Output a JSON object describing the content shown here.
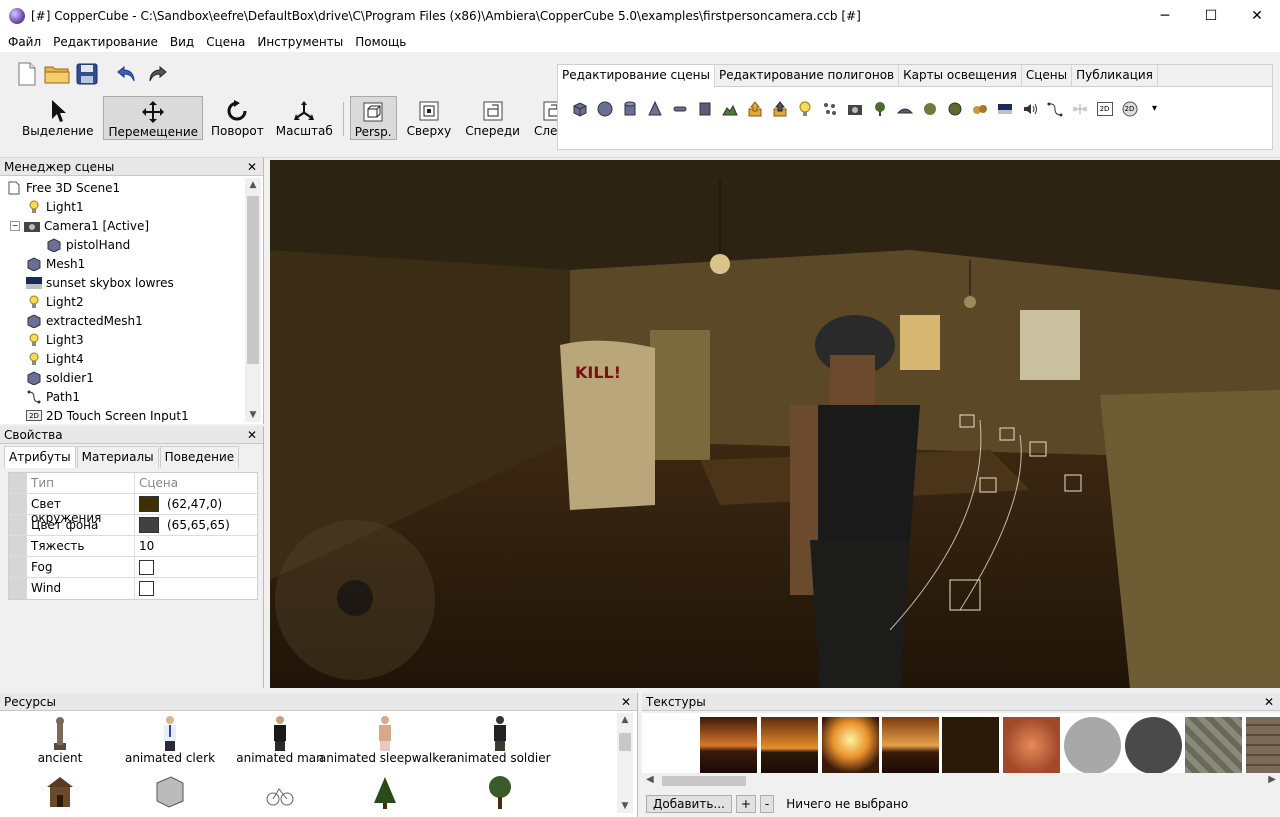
{
  "window": {
    "title": "[#] CopperCube - C:\\Sandbox\\eefre\\DefaultBox\\drive\\C\\Program Files (x86)\\Ambiera\\CopperCube 5.0\\examples\\firstpersoncamera.ccb [#]",
    "minimize": "─",
    "maximize": "☐",
    "close": "✕"
  },
  "menu": [
    "Файл",
    "Редактирование",
    "Вид",
    "Сцена",
    "Инструменты",
    "Помощь"
  ],
  "toolbar": {
    "select": "Выделение",
    "move": "Перемещение",
    "rotate": "Поворот",
    "scale": "Масштаб",
    "persp": "Persp.",
    "top": "Сверху",
    "front": "Спереди",
    "left": "Слева"
  },
  "ribbon": {
    "tabs": [
      "Редактирование сцены",
      "Редактирование полигонов",
      "Карты освещения",
      "Сцены",
      "Публикация"
    ],
    "label_2d": "2D",
    "more": "▾"
  },
  "scene_manager": {
    "title": "Менеджер сцены",
    "close": "✕",
    "items": [
      "Free 3D Scene1",
      "Light1",
      "Camera1 [Active]",
      "pistolHand",
      "Mesh1",
      "sunset skybox lowres",
      "Light2",
      "extractedMesh1",
      "Light3",
      "Light4",
      "soldier1",
      "Path1",
      "2D Touch Screen Input1"
    ],
    "expander": "−",
    "badge_2d": "2D"
  },
  "properties": {
    "title": "Свойства",
    "close": "✕",
    "tabs": [
      "Атрибуты",
      "Материалы",
      "Поведение"
    ],
    "header": {
      "key": "Тип",
      "value": "Сцена"
    },
    "rows": [
      {
        "key": "Свет окружения",
        "value": "(62,47,0)",
        "color": "#3e2f00"
      },
      {
        "key": "Цвет фона",
        "value": "(65,65,65)",
        "color": "#414141"
      },
      {
        "key": "Тяжесть",
        "value": "10"
      },
      {
        "key": "Fog",
        "value": ""
      },
      {
        "key": "Wind",
        "value": ""
      }
    ]
  },
  "viewport": {
    "wall_text": "KILL!"
  },
  "resources": {
    "title": "Ресурсы",
    "close": "✕",
    "items": [
      "ancient",
      "animated clerk",
      "animated man",
      "animated sleepwalker",
      "animated soldier"
    ]
  },
  "textures": {
    "title": "Текстуры",
    "close": "✕",
    "add_button": "Добавить...",
    "plus": "+",
    "minus": "-",
    "status": "Ничего не выбрано"
  }
}
